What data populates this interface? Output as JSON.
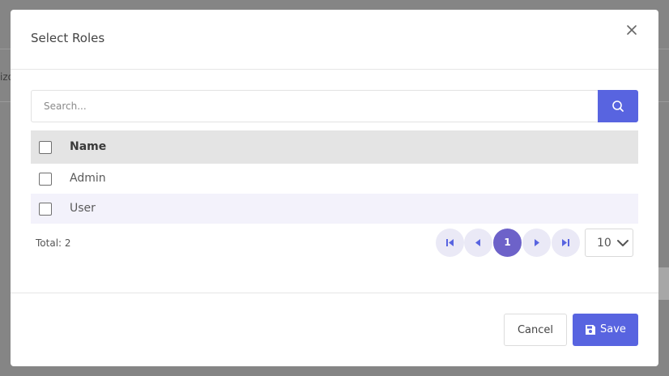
{
  "background": {
    "partial_text": "izo"
  },
  "modal": {
    "title": "Select Roles",
    "close_icon": "close-icon"
  },
  "search": {
    "placeholder": "Search...",
    "value": "",
    "button_icon": "search-icon"
  },
  "table": {
    "columns": [
      "Name"
    ],
    "rows": [
      {
        "name": "Admin",
        "checked": false
      },
      {
        "name": "User",
        "checked": false
      }
    ]
  },
  "pagination": {
    "total_label": "Total: 2",
    "current_page": "1",
    "page_size": "10",
    "icons": [
      "first-page-icon",
      "prev-page-icon",
      "next-page-icon",
      "last-page-icon"
    ]
  },
  "footer": {
    "cancel_label": "Cancel",
    "save_label": "Save",
    "save_icon": "floppy-disk-icon"
  },
  "colors": {
    "primary": "#5864e0",
    "active_page": "#6d62c9",
    "page_button": "#eae9f6",
    "header_row": "#e4e4e4",
    "alt_row": "#f3f2fb"
  }
}
